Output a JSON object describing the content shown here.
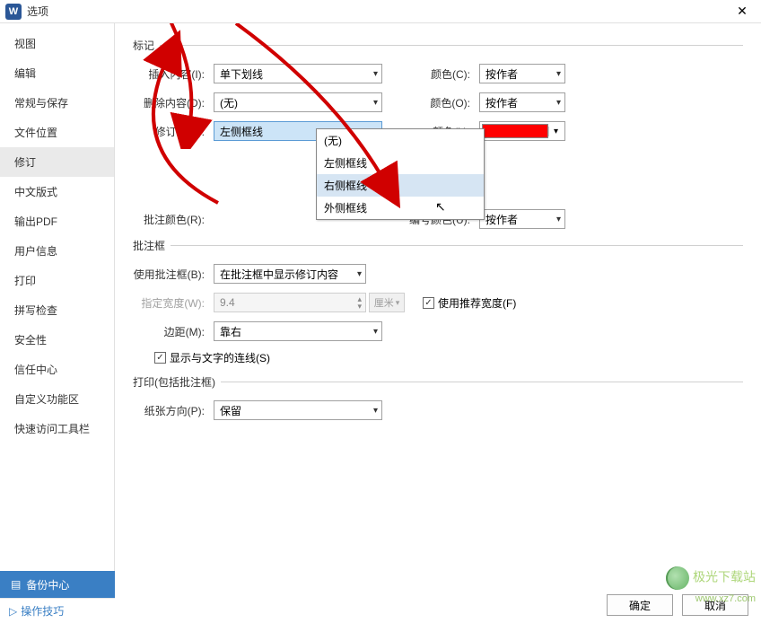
{
  "titlebar": {
    "title": "选项"
  },
  "sidebar": {
    "items": [
      {
        "label": "视图"
      },
      {
        "label": "编辑"
      },
      {
        "label": "常规与保存"
      },
      {
        "label": "文件位置"
      },
      {
        "label": "修订"
      },
      {
        "label": "中文版式"
      },
      {
        "label": "输出PDF"
      },
      {
        "label": "用户信息"
      },
      {
        "label": "打印"
      },
      {
        "label": "拼写检查"
      },
      {
        "label": "安全性"
      },
      {
        "label": "信任中心"
      },
      {
        "label": "自定义功能区"
      },
      {
        "label": "快速访问工具栏"
      }
    ],
    "active_index": 4,
    "backup_label": "备份中心",
    "tips_label": "操作技巧"
  },
  "sections": {
    "mark": {
      "title": "标记",
      "insert_label": "插入内容(I):",
      "insert_value": "单下划线",
      "delete_label": "删除内容(D):",
      "delete_value": "(无)",
      "revised_label": "修订行(A):",
      "revised_value": "左侧框线",
      "comment_color_label": "批注颜色(R):",
      "color_label_c": "颜色(C):",
      "color_label_o": "颜色(O):",
      "color_label_l": "颜色(L):",
      "byauthor": "按作者",
      "number_color_label": "编号颜色(U):",
      "revised_color": "#ff0000"
    },
    "balloon": {
      "title": "批注框",
      "use_label": "使用批注框(B):",
      "use_value": "在批注框中显示修订内容",
      "width_label": "指定宽度(W):",
      "width_value": "9.4",
      "width_unit": "厘米",
      "recommended_label": "使用推荐宽度(F)",
      "margin_label": "边距(M):",
      "margin_value": "靠右",
      "showline_label": "显示与文字的连线(S)"
    },
    "print": {
      "title": "打印(包括批注框)",
      "orient_label": "纸张方向(P):",
      "orient_value": "保留"
    }
  },
  "dropdown": {
    "items": [
      "(无)",
      "左侧框线",
      "右侧框线",
      "外侧框线"
    ],
    "hover_index": 2
  },
  "footer": {
    "ok": "确定",
    "cancel": "取消"
  },
  "watermark": {
    "text": "极光下载站",
    "url": "www.xz7.com"
  }
}
